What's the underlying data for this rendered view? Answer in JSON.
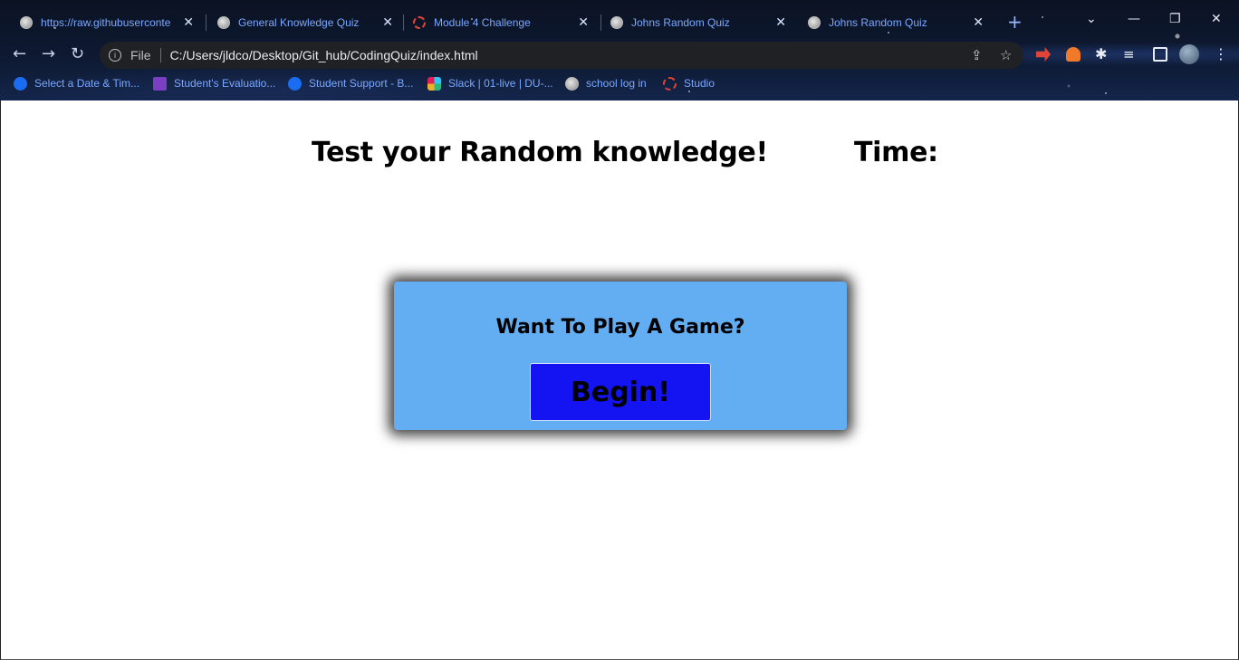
{
  "browser": {
    "tabs": [
      {
        "title": "https://raw.githubuserconte",
        "favicon": "globe-icon"
      },
      {
        "title": "General Knowledge Quiz",
        "favicon": "globe-icon"
      },
      {
        "title": "Module 4 Challenge",
        "favicon": "dashed-ring-icon"
      },
      {
        "title": "Johns Random Quiz",
        "favicon": "globe-icon"
      },
      {
        "title": "Johns Random Quiz",
        "favicon": "globe-icon"
      }
    ],
    "tab_close_glyph": "✕",
    "new_tab_glyph": "+",
    "address": {
      "scheme_label": "File",
      "url": "C:/Users/jldco/Desktop/Git_hub/CodingQuiz/index.html"
    },
    "bookmarks": [
      {
        "label": "Select a Date & Tim...",
        "icon": "calendly-icon"
      },
      {
        "label": "Student's Evaluatio...",
        "icon": "forms-icon"
      },
      {
        "label": "Student Support - B...",
        "icon": "calendly-icon"
      },
      {
        "label": "Slack | 01-live | DU-...",
        "icon": "slack-icon"
      },
      {
        "label": "school log in",
        "icon": "globe-icon"
      },
      {
        "label": "Studio",
        "icon": "dashed-ring-icon"
      }
    ]
  },
  "page": {
    "heading": "Test your Random knowledge!",
    "timer_label": "Time:",
    "card": {
      "title": "Want To Play A Game?",
      "begin_label": "Begin!"
    }
  },
  "colors": {
    "card_bg": "#63adf2",
    "button_bg": "#1414f2",
    "tab_text": "#7aa7ff"
  }
}
